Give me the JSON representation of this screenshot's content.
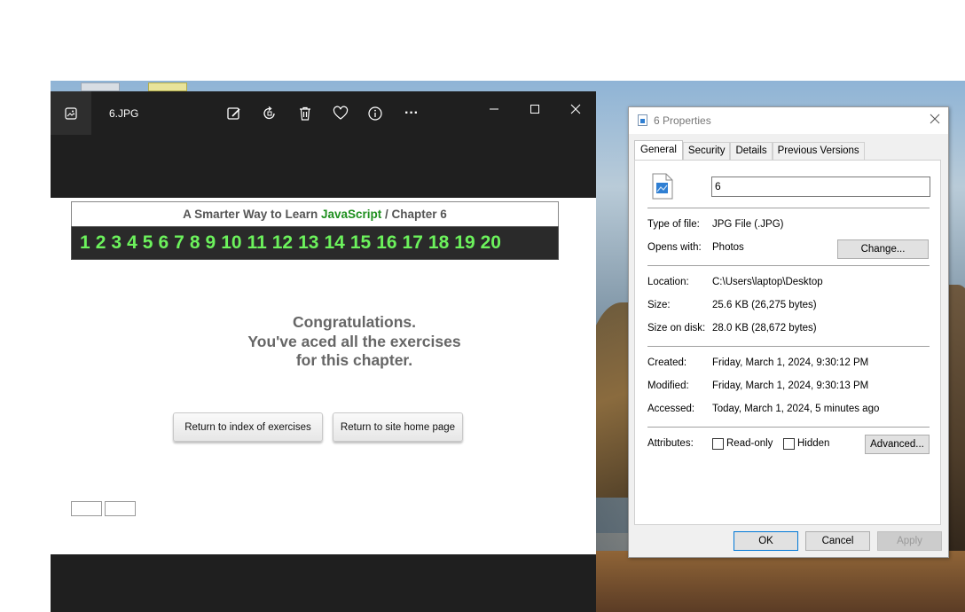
{
  "photos_app": {
    "filename": "6.JPG",
    "toolbar": [
      "edit-icon",
      "rotate-icon",
      "delete-icon",
      "favorite-icon",
      "info-icon",
      "more-icon"
    ],
    "more_label": "···",
    "content": {
      "header_prefix": "A Smarter Way to Learn",
      "header_highlight": "JavaScript",
      "header_suffix": "/  Chapter 6",
      "chapter_numbers": [
        "1",
        "2",
        "3",
        "4",
        "5",
        "6",
        "7",
        "8",
        "9",
        "10",
        "11",
        "12",
        "13",
        "14",
        "15",
        "16",
        "17",
        "18",
        "19",
        "20"
      ],
      "congrats_line1": "Congratulations.",
      "congrats_line2": "You've aced all the exercises",
      "congrats_line3": "for this chapter.",
      "btn_index": "Return to index of exercises",
      "btn_home": "Return to site home page"
    }
  },
  "properties_dialog": {
    "title": "6 Properties",
    "tabs": [
      "General",
      "Security",
      "Details",
      "Previous Versions"
    ],
    "active_tab": "General",
    "name_value": "6",
    "rows": {
      "type_label": "Type of file:",
      "type_value": "JPG File (.JPG)",
      "opens_label": "Opens with:",
      "opens_value": "Photos",
      "change_button": "Change...",
      "location_label": "Location:",
      "location_value": "C:\\Users\\laptop\\Desktop",
      "size_label": "Size:",
      "size_value": "25.6 KB (26,275 bytes)",
      "sizedisk_label": "Size on disk:",
      "sizedisk_value": "28.0 KB (28,672 bytes)",
      "created_label": "Created:",
      "created_value": "Friday, March 1, 2024, 9:30:12 PM",
      "modified_label": "Modified:",
      "modified_value": "Friday, March 1, 2024, 9:30:13 PM",
      "accessed_label": "Accessed:",
      "accessed_value": "Today, March 1, 2024, 5 minutes ago",
      "attributes_label": "Attributes:",
      "readonly_label": "Read-only",
      "hidden_label": "Hidden",
      "advanced_button": "Advanced..."
    },
    "buttons": {
      "ok": "OK",
      "cancel": "Cancel",
      "apply": "Apply"
    }
  },
  "colors": {
    "accent_js": "#1e8f1e",
    "chapter_numbers": "#6cf25c",
    "photos_bg": "#1f1f1f"
  }
}
